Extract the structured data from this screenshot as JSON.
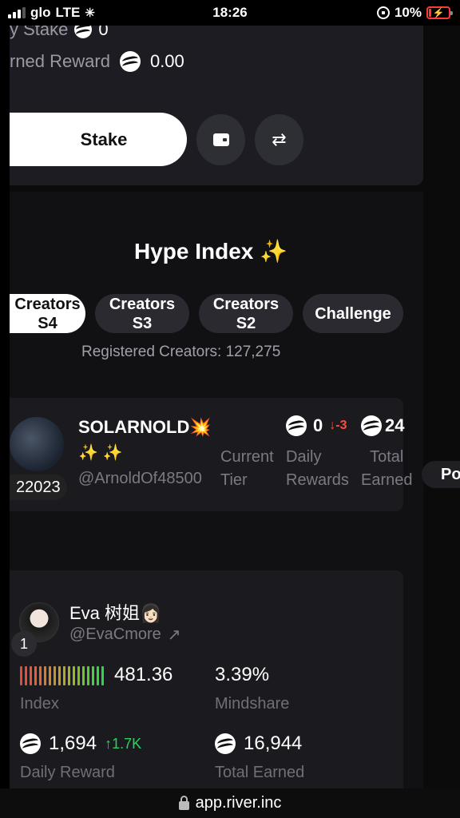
{
  "status_bar": {
    "carrier": "glo",
    "network": "LTE",
    "time": "18:26",
    "battery": "10%"
  },
  "stake_card": {
    "my_stake_label": "y Stake",
    "my_stake_value": "0",
    "earned_label": "rned Reward",
    "earned_value": "0.00",
    "stake_button": "Stake",
    "wallet_icon": "wallet-icon",
    "swap_icon": "swap-arrows-icon"
  },
  "hype": {
    "title": "Hype Index",
    "sparkle": "✨",
    "tabs": [
      {
        "line1": "Creators",
        "line2": "S4",
        "active": true
      },
      {
        "line1": "Creators",
        "line2": "S3",
        "active": false
      },
      {
        "line1": "Creators",
        "line2": "S2",
        "active": false
      },
      {
        "line1": "Challenge",
        "line2": "",
        "active": false
      }
    ],
    "registered": "Registered Creators: 127,275"
  },
  "user_card": {
    "year": "22023",
    "name": "SOLARNOLD💥",
    "sparkles": "✨ ✨",
    "handle": "@ArnoldOf48500",
    "tier_label_1": "Current",
    "tier_label_2": "Tier",
    "daily_value": "0",
    "daily_change": "↓-3",
    "daily_label_1": "Daily",
    "daily_label_2": "Rewards",
    "total_value": "24",
    "total_label_1": "Total",
    "total_label_2": "Earned",
    "side_pill": "Po"
  },
  "eva_card": {
    "rank": "1",
    "name": "Eva 树姐👩🏻",
    "handle": "@EvaCmore",
    "index_value": "481.36",
    "index_label": "Index",
    "mindshare_value": "3.39%",
    "mindshare_label": "Mindshare",
    "daily_reward_value": "1,694",
    "daily_reward_change": "↑1.7K",
    "daily_reward_label": "Daily Reward",
    "total_earned_value": "16,944",
    "total_earned_label": "Total Earned",
    "meter_colors": [
      "#e04a3a",
      "#e4503a",
      "#e5583a",
      "#e26238",
      "#dc6c36",
      "#d77a34",
      "#cf8732",
      "#c79330",
      "#bd9e2e",
      "#b2a82d",
      "#a4b12c",
      "#94b92c",
      "#82bf2e",
      "#6fc532",
      "#5bcb38",
      "#48d040",
      "#38d448",
      "#2bd850"
    ]
  },
  "url_bar": {
    "url": "app.river.inc"
  }
}
